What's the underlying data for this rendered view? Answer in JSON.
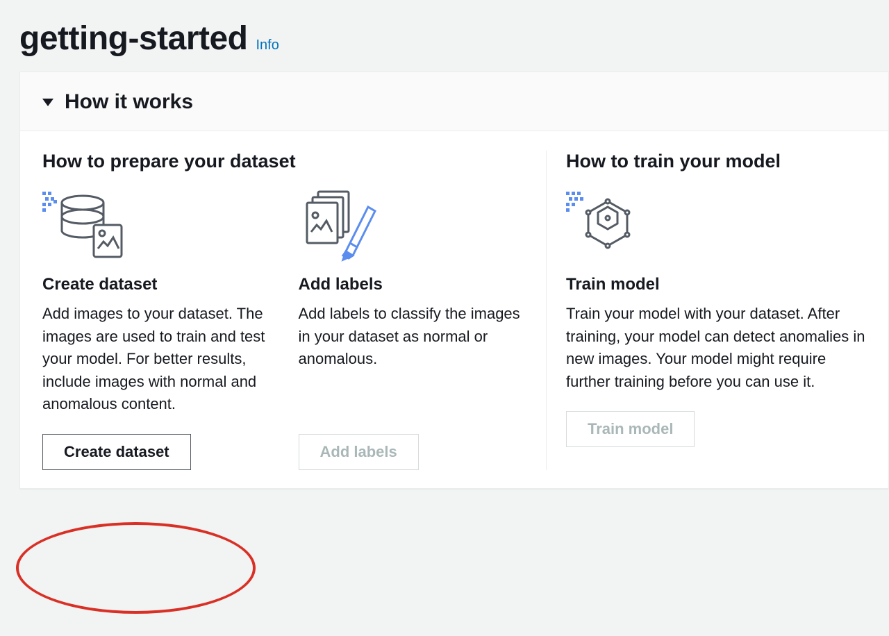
{
  "header": {
    "title": "getting-started",
    "info_label": "Info"
  },
  "panel": {
    "title": "How it works"
  },
  "left_section": {
    "title": "How to prepare your dataset",
    "steps": [
      {
        "icon": "dataset-icon",
        "title": "Create dataset",
        "desc": "Add images to your dataset. The images are used to train and test your model. For better results, include images with normal and anomalous content.",
        "button": "Create dataset",
        "button_disabled": false
      },
      {
        "icon": "labels-icon",
        "title": "Add labels",
        "desc": "Add labels to classify the images in your dataset as normal or anomalous.",
        "button": "Add labels",
        "button_disabled": true
      }
    ]
  },
  "right_section": {
    "title": "How to train your model",
    "steps": [
      {
        "icon": "train-icon",
        "title": "Train model",
        "desc": "Train your model with your dataset. After training, your model can detect anomalies in new images. Your model might require further training before you can use it.",
        "button": "Train model",
        "button_disabled": true
      }
    ]
  }
}
